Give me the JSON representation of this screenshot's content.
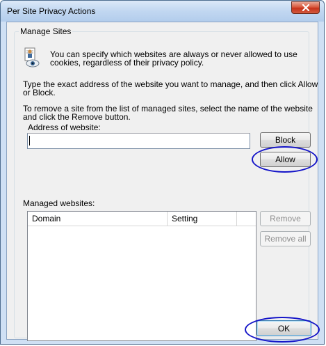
{
  "window": {
    "title": "Per Site Privacy Actions"
  },
  "group": {
    "legend": "Manage Sites"
  },
  "info": {
    "line1": "You can specify which websites are always or never allowed to use",
    "line2": "cookies, regardless of their privacy policy."
  },
  "instructions": {
    "p1_line1": "Type the exact address of the website you want to manage, and then click Allow",
    "p1_line2": "or Block.",
    "p2_line1": "To remove a site from the list of managed sites, select the name of the website",
    "p2_line2": "and click the Remove button."
  },
  "address": {
    "label": "Address of website:",
    "value": ""
  },
  "buttons": {
    "block": "Block",
    "allow": "Allow",
    "remove": "Remove",
    "remove_all": "Remove all",
    "ok": "OK"
  },
  "managed": {
    "label": "Managed websites:",
    "columns": [
      "Domain",
      "Setting"
    ],
    "rows": []
  },
  "colors": {
    "highlight_oval": "#1414c8",
    "close_button": "#c7321a"
  }
}
